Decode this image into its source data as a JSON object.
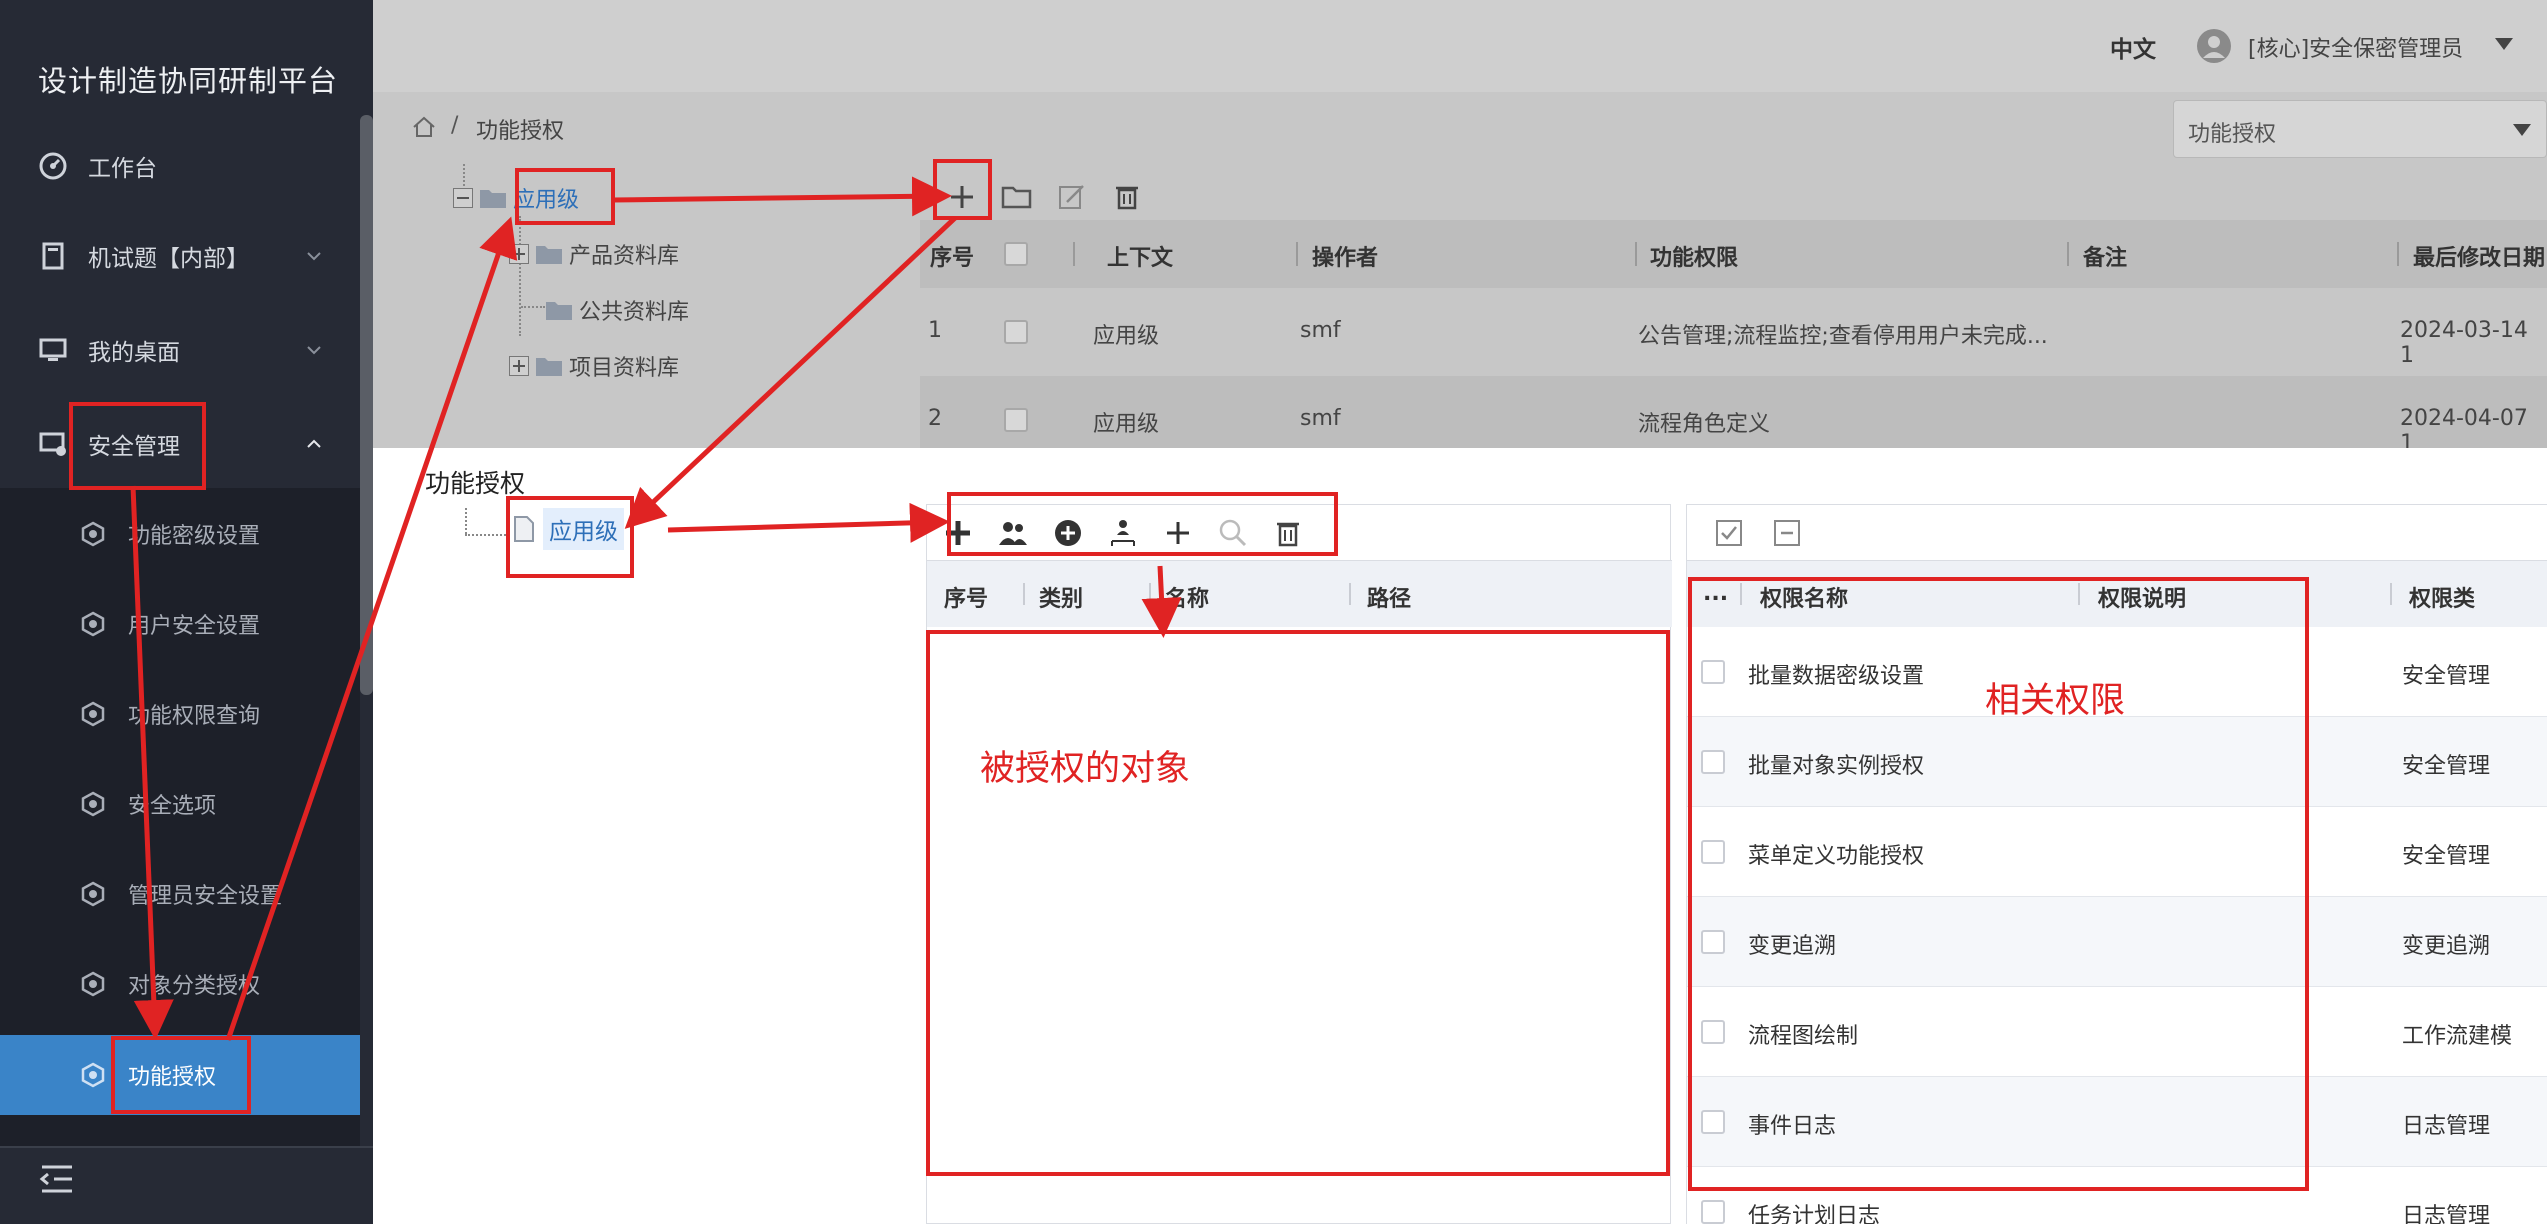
{
  "sidebar": {
    "title": "设计制造协同研制平台",
    "top_items": [
      {
        "label": "工作台",
        "icon": "dashboard-icon"
      },
      {
        "label": "机试题【内部】",
        "icon": "document-icon"
      },
      {
        "label": "我的桌面",
        "icon": "monitor-icon"
      },
      {
        "label": "安全管理",
        "icon": "security-monitor-icon"
      }
    ],
    "sub_items": [
      {
        "label": "功能密级设置"
      },
      {
        "label": "用户安全设置"
      },
      {
        "label": "功能权限查询"
      },
      {
        "label": "安全选项"
      },
      {
        "label": "管理员安全设置"
      },
      {
        "label": "对象分类授权"
      },
      {
        "label": "功能授权"
      }
    ]
  },
  "topbar": {
    "lang": "中文",
    "user": "[核心]安全保密管理员"
  },
  "breadcrumb": {
    "current": "功能授权",
    "select_value": "功能授权"
  },
  "upper_tree": {
    "root": "应用级",
    "children": [
      "产品资料库",
      "公共资料库",
      "项目资料库"
    ]
  },
  "upper_grid": {
    "columns": [
      "序号",
      "上下文",
      "操作者",
      "功能权限",
      "备注",
      "最后修改日期"
    ],
    "rows": [
      {
        "no": "1",
        "context": "应用级",
        "operator": "smf",
        "perm": "公告管理;流程监控;查看停用用户未完成...",
        "remark": "",
        "date": "2024-03-14 1"
      },
      {
        "no": "2",
        "context": "应用级",
        "operator": "smf",
        "perm": "流程角色定义",
        "remark": "",
        "date": "2024-04-07 1"
      }
    ]
  },
  "lower": {
    "title": "功能授权",
    "node": "应用级",
    "object_columns": [
      "序号",
      "类别",
      "名称",
      "路径"
    ],
    "perm_columns": [
      "...",
      "权限名称",
      "权限说明",
      "权限类"
    ],
    "perm_rows": [
      {
        "name": "批量数据密级设置",
        "cat": "安全管理"
      },
      {
        "name": "批量对象实例授权",
        "cat": "安全管理"
      },
      {
        "name": "菜单定义功能授权",
        "cat": "安全管理"
      },
      {
        "name": "变更追溯",
        "cat": "变更追溯"
      },
      {
        "name": "流程图绘制",
        "cat": "工作流建模"
      },
      {
        "name": "事件日志",
        "cat": "日志管理"
      },
      {
        "name": "任务计划日志",
        "cat": "日志管理"
      }
    ]
  },
  "annotations": {
    "objects": "被授权的对象",
    "perms": "相关权限"
  },
  "colors": {
    "accent": "#3a84c8",
    "annotation": "#e02323",
    "sidebar": "#262a35"
  }
}
